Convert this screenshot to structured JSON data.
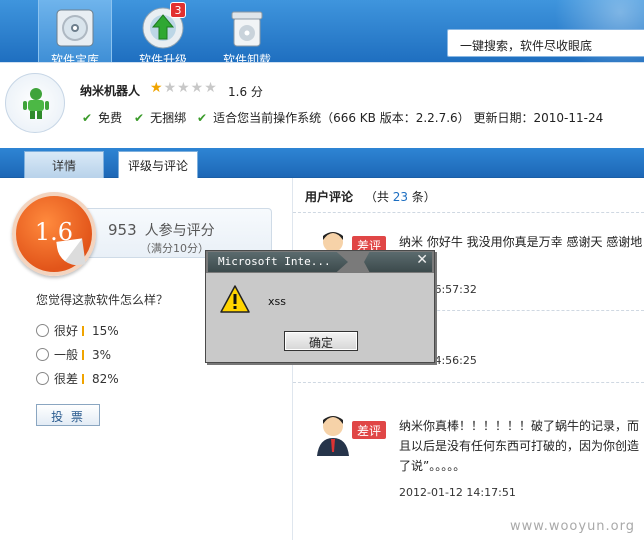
{
  "toolbar": {
    "tools": [
      {
        "label": "软件宝库",
        "icon": "cd-icon",
        "active": true
      },
      {
        "label": "软件升级",
        "icon": "upgrade-icon",
        "badge": "3"
      },
      {
        "label": "软件卸载",
        "icon": "trash-icon"
      }
    ],
    "search_placeholder": "一键搜索，软件尽收眼底"
  },
  "app": {
    "name": "纳米机器人",
    "score": "1.6 分",
    "features": [
      "免费",
      "无捆绑",
      "适合您当前操作系统（666 KB 版本：2.2.7.6） 更新日期：2010-11-24"
    ]
  },
  "tabs": {
    "details": "详情",
    "reviews": "评级与评论"
  },
  "rating": {
    "score": "1.6",
    "votes": "953",
    "votes_suffix": "人参与评分",
    "full": "（满分10分）",
    "question": "您觉得这款软件怎么样？",
    "options": [
      {
        "label": "很好",
        "pct": "15%"
      },
      {
        "label": "一般",
        "pct": "3%"
      },
      {
        "label": "很差",
        "pct": "82%"
      }
    ],
    "vote_button": "投 票"
  },
  "comments": {
    "header": "用户评论",
    "count_prefix": "（共",
    "count": "23",
    "count_suffix": "条）",
    "items": [
      {
        "tag": "差评",
        "text": "纳米 你好牛 我没用你真是万幸 感谢天 感谢地 软件",
        "date": "5-06 16:57:32"
      },
      {
        "tag": "差评",
        "text": "",
        "date": "3-16 14:56:25"
      },
      {
        "tag": "差评",
        "text": "纳米你真棒！！！！！！破了蜗牛的记录，而且以后是没有任何东西可打破的，因为你创造了说”。。。。。",
        "date": "2012-01-12 14:17:51"
      }
    ]
  },
  "dialog": {
    "title": "Microsoft Inte...",
    "message": "xss",
    "ok": "确定"
  },
  "watermark": "www.wooyun.org",
  "colors": {
    "accent": "#1f6fc0",
    "badge": "#e23030",
    "score": "#e2551a",
    "tag": "#e04646"
  }
}
